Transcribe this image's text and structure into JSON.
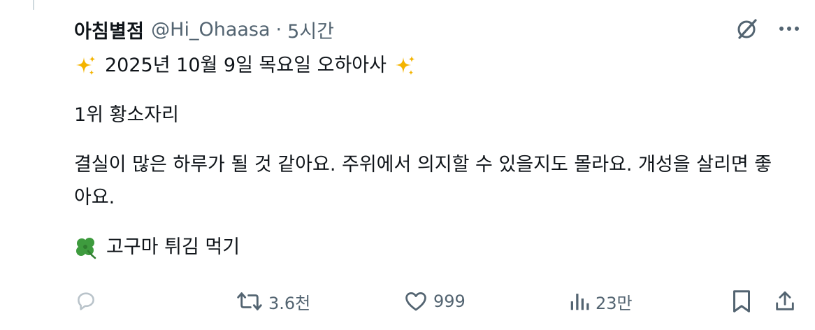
{
  "tweet": {
    "author_name": "아침별점",
    "handle": "@Hi_Ohaasa",
    "separator": "·",
    "time": "5시간",
    "lines": {
      "title": "2025년 10월 9일 목요일 오하아사",
      "rank": "1위 황소자리",
      "fortune_1": "결실이 많은 하루가 될 것 같아요. 주위에서 의지할 수 있을지도 몰라요. 개성을 살리면 좋",
      "fortune_2": "아요.",
      "lucky": "고구마 튀김 먹기"
    }
  },
  "icons": {
    "grok": "grok-icon",
    "more": "more-icon",
    "sparkle": "sparkles-emoji",
    "clover": "four-leaf-clover-emoji",
    "reply": "reply-icon",
    "retweet": "retweet-icon",
    "like": "heart-icon",
    "views": "views-icon",
    "bookmark": "bookmark-icon",
    "share": "share-icon"
  },
  "actions": {
    "reply_count": "",
    "retweet_count": "3.6천",
    "like_count": "999",
    "views_count": "23만"
  },
  "colors": {
    "text": "#0f1419",
    "secondary": "#536471",
    "sparkle": "#f4b400",
    "clover": "#3e9b3e",
    "reply_icon": "#b9c3ca"
  }
}
